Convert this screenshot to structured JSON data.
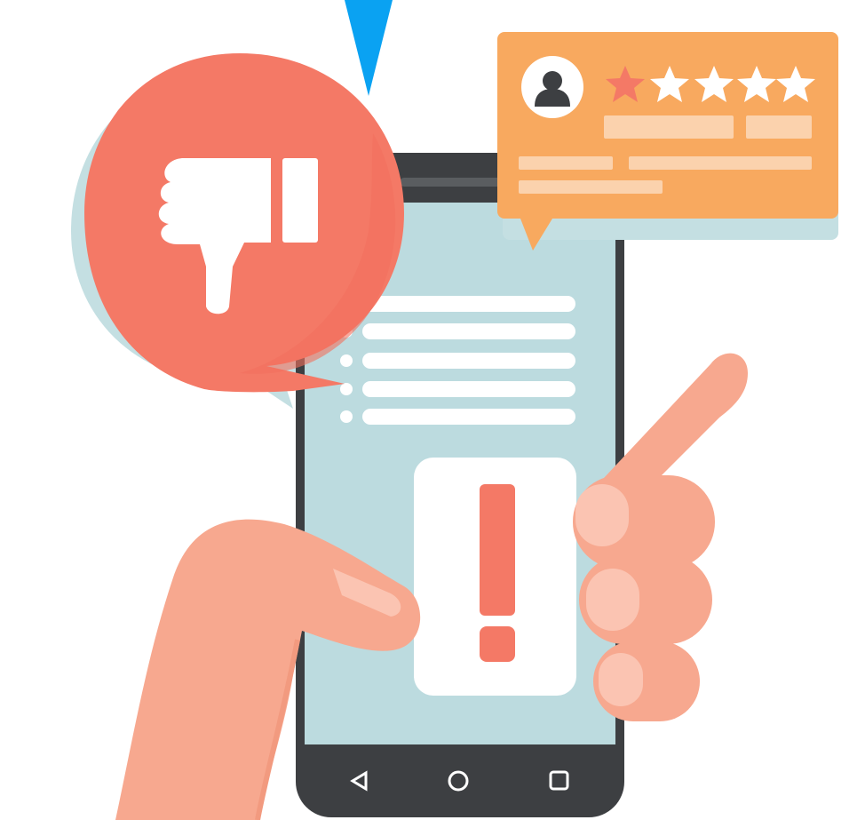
{
  "illustration": {
    "review_card": {
      "rating_value": 1,
      "rating_max": 5
    },
    "phone_screen": {
      "text_line_count": 5,
      "alert_symbol": "!"
    },
    "nav_bar": {
      "back_icon": "triangle-back-icon",
      "home_icon": "circle-home-icon",
      "recents_icon": "square-recents-icon"
    },
    "colors": {
      "accent_red": "#f47966",
      "card_orange": "#f8a95f",
      "screen_blue": "#bcdbdf",
      "skin": "#f7a88f",
      "pointer_blue": "#0aa2f2",
      "phone_frame": "#3d3f42"
    }
  }
}
